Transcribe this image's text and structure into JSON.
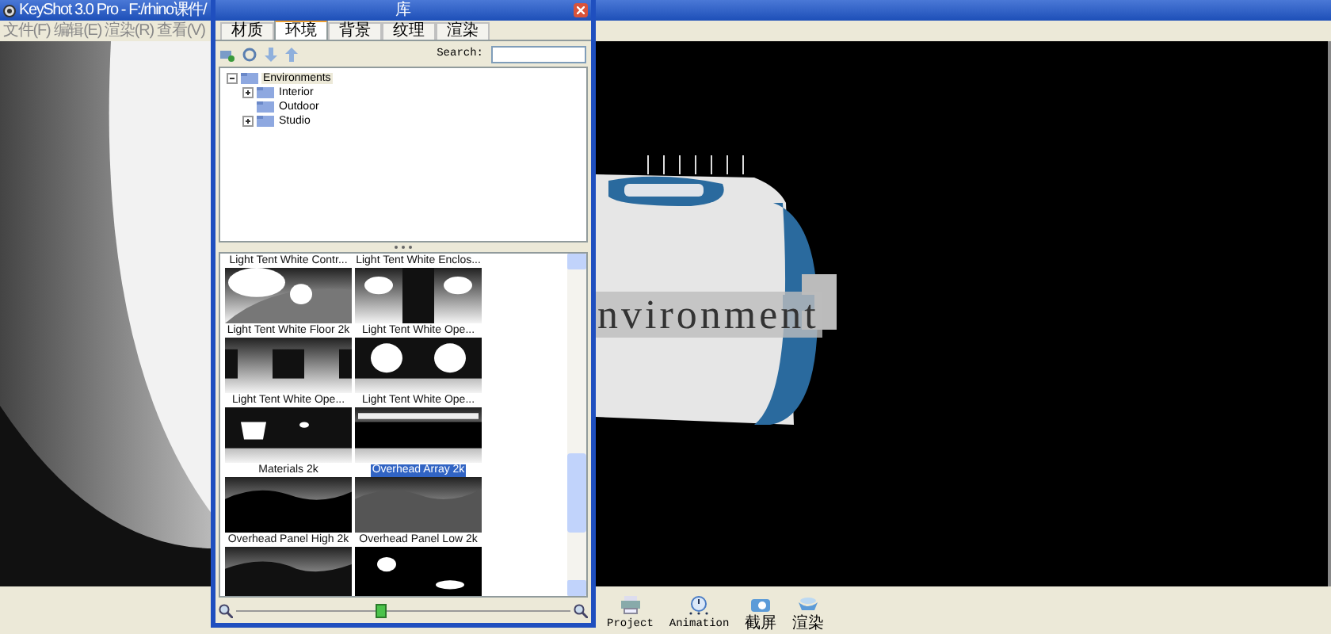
{
  "main_window": {
    "title": "KeyShot 3.0 Pro - F:/rhino课件/",
    "menu": [
      "文件(F)",
      "编辑(E)",
      "渲染(R)",
      "查看(V)"
    ]
  },
  "viewport": {
    "overlay_text": "nvironment"
  },
  "toolbar": [
    {
      "kind": "project",
      "label": "Project"
    },
    {
      "kind": "animation",
      "label": "Animation"
    },
    {
      "kind": "screenshot",
      "label": "截屏"
    },
    {
      "kind": "render",
      "label": "渲染"
    }
  ],
  "library": {
    "title": "库",
    "tabs": [
      {
        "label": "材质",
        "selected": false
      },
      {
        "label": "环境",
        "selected": true
      },
      {
        "label": "背景",
        "selected": false
      },
      {
        "label": "纹理",
        "selected": false
      },
      {
        "label": "渲染",
        "selected": false
      }
    ],
    "search": {
      "label": "Search:"
    },
    "tree": [
      {
        "label": "Environments",
        "expandable": true,
        "expanded": true,
        "selected": true,
        "children": [
          {
            "label": "Interior",
            "expandable": true,
            "selected": false
          },
          {
            "label": "Outdoor",
            "expandable": false,
            "selected": false
          },
          {
            "label": "Studio",
            "expandable": true,
            "selected": false
          }
        ]
      }
    ],
    "thumbnails": [
      {
        "label": "Light Tent White Contr...",
        "selected": false
      },
      {
        "label": "Light Tent White Enclos...",
        "selected": false
      },
      {
        "label": "Light Tent White Floor 2k",
        "selected": false
      },
      {
        "label": "Light Tent White Ope...",
        "selected": false
      },
      {
        "label": "Light Tent White Ope...",
        "selected": false
      },
      {
        "label": "Light Tent White Ope...",
        "selected": false
      },
      {
        "label": "Materials 2k",
        "selected": false
      },
      {
        "label": "Overhead Array 2k",
        "selected": true
      },
      {
        "label": "Overhead Panel High 2k",
        "selected": false
      },
      {
        "label": "Overhead Panel Low 2k",
        "selected": false
      }
    ],
    "zoom": {
      "level": 0.43
    }
  }
}
